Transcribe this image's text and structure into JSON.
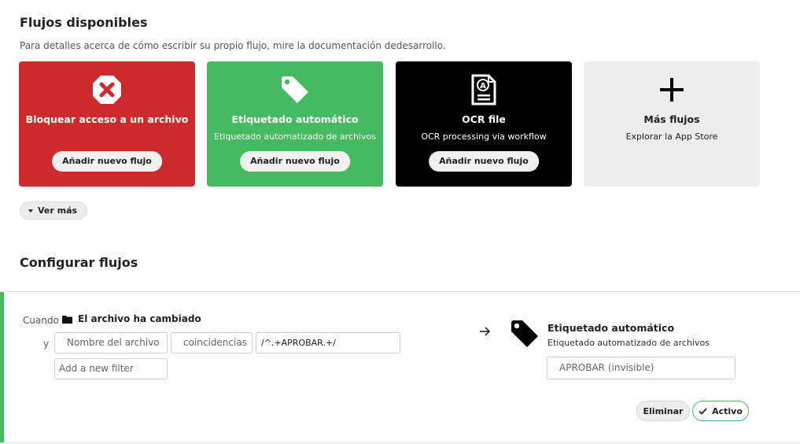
{
  "section_available": {
    "title": "Flujos disponibles",
    "subtitle": "Para detalles acerca de cómo escribir su propio flujo, mire la documentación dedesarrollo."
  },
  "cards": [
    {
      "title": "Bloquear acceso a un archivo",
      "description": "",
      "button": "Añadir nuevo flujo",
      "icon": "close-circle-icon",
      "color": "#cd2b2b"
    },
    {
      "title": "Etiquetado automático",
      "description": "Etiquetado automatizado de archivos",
      "button": "Añadir nuevo flujo",
      "icon": "tag-icon",
      "color": "#46ba61"
    },
    {
      "title": "OCR file",
      "description": "OCR processing via workflow",
      "button": "Añadir nuevo flujo",
      "icon": "ocr-document-icon",
      "color": "#000000"
    },
    {
      "title": "Más flujos",
      "description": "Explorar la App Store",
      "button": "",
      "icon": "plus-icon",
      "color": "#ededed"
    }
  ],
  "see_more": {
    "label": "Ver más",
    "icon": "caret-down-icon"
  },
  "section_configure": {
    "title": "Configurar flujos"
  },
  "rule": {
    "when_label": "Cuando",
    "event": {
      "label": "El archivo ha cambiado",
      "icon": "folder-icon"
    },
    "and_label": "y",
    "filter": {
      "property": "Nombre del archivo",
      "operator": "coincidencias",
      "value": "/^.+APROBAR.+/"
    },
    "add_filter_placeholder": "Add a new filter",
    "operation": {
      "title": "Etiquetado automático",
      "description": "Etiquetado automatizado de archivos",
      "tag_value": "APROBAR (invisible)",
      "icon": "tag-icon"
    },
    "delete_label": "Eliminar",
    "active_label": "Activo",
    "accent_color": "#46ba61"
  }
}
